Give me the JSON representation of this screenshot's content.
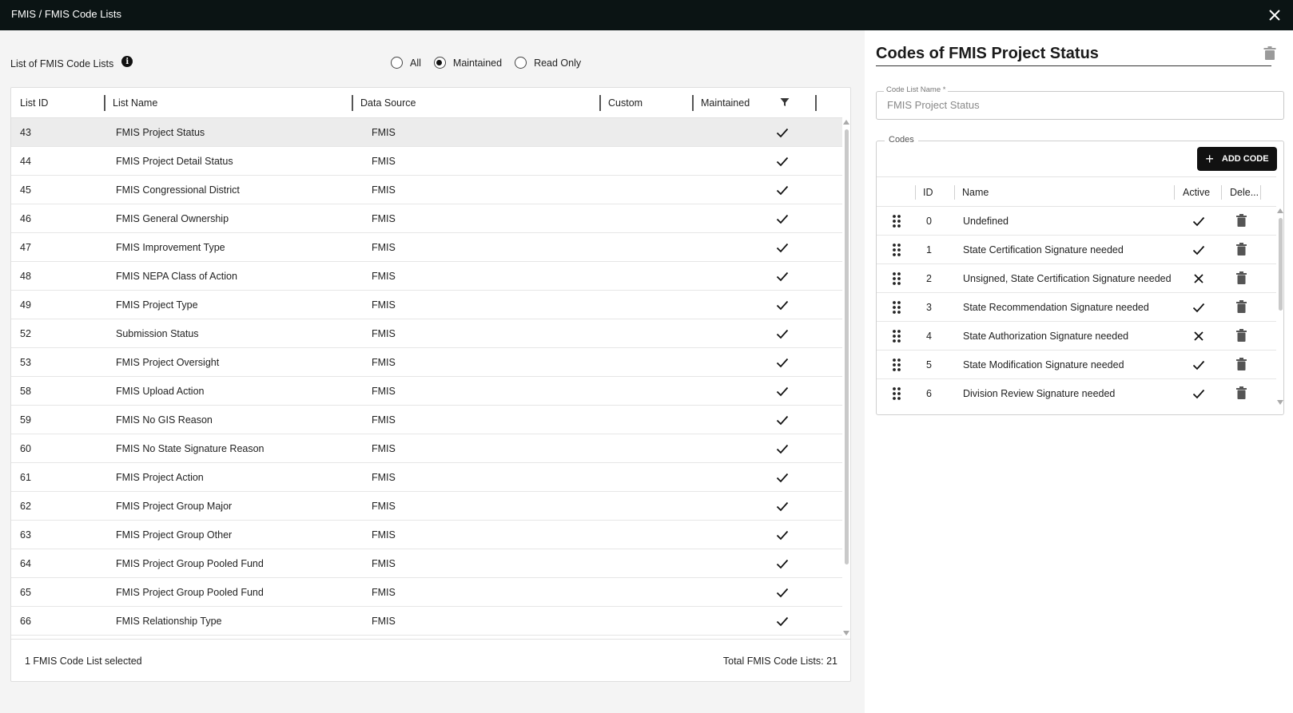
{
  "window": {
    "title": "FMIS / FMIS Code Lists"
  },
  "left": {
    "heading": "List of FMIS Code Lists",
    "filters": [
      {
        "label": "All",
        "selected": false
      },
      {
        "label": "Maintained",
        "selected": true
      },
      {
        "label": "Read Only",
        "selected": false
      }
    ],
    "columns": [
      "List ID",
      "List Name",
      "Data Source",
      "Custom",
      "Maintained"
    ],
    "rows": [
      {
        "id": "43",
        "name": "FMIS Project Status",
        "source": "FMIS",
        "custom": "",
        "maintained": true,
        "selected": true
      },
      {
        "id": "44",
        "name": "FMIS Project Detail Status",
        "source": "FMIS",
        "custom": "",
        "maintained": true
      },
      {
        "id": "45",
        "name": "FMIS Congressional District",
        "source": "FMIS",
        "custom": "",
        "maintained": true
      },
      {
        "id": "46",
        "name": "FMIS General Ownership",
        "source": "FMIS",
        "custom": "",
        "maintained": true
      },
      {
        "id": "47",
        "name": "FMIS Improvement Type",
        "source": "FMIS",
        "custom": "",
        "maintained": true
      },
      {
        "id": "48",
        "name": "FMIS NEPA Class of Action",
        "source": "FMIS",
        "custom": "",
        "maintained": true
      },
      {
        "id": "49",
        "name": "FMIS Project Type",
        "source": "FMIS",
        "custom": "",
        "maintained": true
      },
      {
        "id": "52",
        "name": "Submission Status",
        "source": "FMIS",
        "custom": "",
        "maintained": true
      },
      {
        "id": "53",
        "name": "FMIS Project Oversight",
        "source": "FMIS",
        "custom": "",
        "maintained": true
      },
      {
        "id": "58",
        "name": "FMIS Upload Action",
        "source": "FMIS",
        "custom": "",
        "maintained": true
      },
      {
        "id": "59",
        "name": "FMIS No GIS Reason",
        "source": "FMIS",
        "custom": "",
        "maintained": true
      },
      {
        "id": "60",
        "name": "FMIS No State Signature Reason",
        "source": "FMIS",
        "custom": "",
        "maintained": true
      },
      {
        "id": "61",
        "name": "FMIS Project Action",
        "source": "FMIS",
        "custom": "",
        "maintained": true
      },
      {
        "id": "62",
        "name": "FMIS Project Group Major",
        "source": "FMIS",
        "custom": "",
        "maintained": true
      },
      {
        "id": "63",
        "name": "FMIS Project Group Other",
        "source": "FMIS",
        "custom": "",
        "maintained": true
      },
      {
        "id": "64",
        "name": "FMIS Project Group Pooled Fund",
        "source": "FMIS",
        "custom": "",
        "maintained": true
      },
      {
        "id": "65",
        "name": "FMIS Project Group Pooled Fund",
        "source": "FMIS",
        "custom": "",
        "maintained": true
      },
      {
        "id": "66",
        "name": "FMIS Relationship Type",
        "source": "FMIS",
        "custom": "",
        "maintained": true
      }
    ],
    "footer": {
      "selected_text": "1 FMIS Code List selected",
      "total_text": "Total FMIS Code Lists: 21"
    }
  },
  "detail": {
    "title": "Codes of FMIS Project Status",
    "code_list_name_label": "Code List Name *",
    "code_list_name_value": "FMIS Project Status",
    "codes_legend": "Codes",
    "add_code_label": "ADD CODE",
    "columns": [
      "ID",
      "Name",
      "Active",
      "Dele..."
    ],
    "codes": [
      {
        "id": "0",
        "name": "Undefined",
        "active": true
      },
      {
        "id": "1",
        "name": "State Certification Signature needed",
        "active": true
      },
      {
        "id": "2",
        "name": "Unsigned, State Certification Signature needed",
        "active": false
      },
      {
        "id": "3",
        "name": "State Recommendation Signature needed",
        "active": true
      },
      {
        "id": "4",
        "name": "State Authorization Signature needed",
        "active": false
      },
      {
        "id": "5",
        "name": "State Modification Signature needed",
        "active": true
      },
      {
        "id": "6",
        "name": "Division Review Signature needed",
        "active": true
      }
    ]
  },
  "colors": {
    "titlebar": "#0b1414",
    "primary_button": "#111111",
    "selected_row": "#ececec"
  }
}
